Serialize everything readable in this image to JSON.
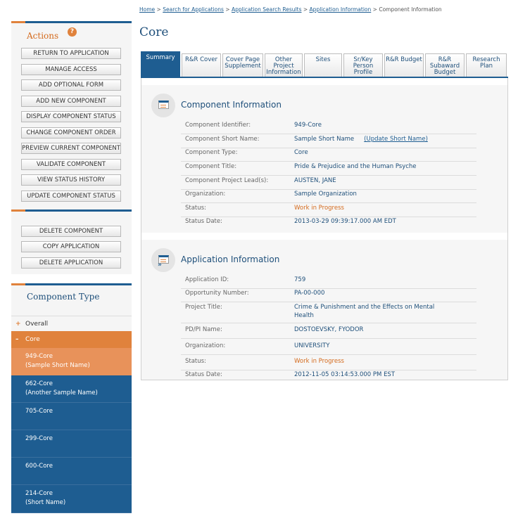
{
  "breadcrumb": [
    "Home",
    "Search for Applications",
    "Application Search Results",
    "Application Information",
    "Component Information"
  ],
  "page_title": "Core",
  "sidebar": {
    "actions_title": "Actions",
    "help_icon": "?",
    "action_buttons": [
      "RETURN TO APPLICATION",
      "MANAGE ACCESS",
      "ADD OPTIONAL FORM",
      "ADD NEW COMPONENT",
      "DISPLAY COMPONENT STATUS",
      "CHANGE COMPONENT ORDER",
      "PREVIEW CURRENT COMPONENT",
      "VALIDATE COMPONENT",
      "VIEW STATUS HISTORY",
      "UPDATE COMPONENT STATUS"
    ],
    "danger_buttons": [
      "DELETE COMPONENT",
      "COPY APPLICATION",
      "DELETE APPLICATION"
    ],
    "component_type_title": "Component Type",
    "tree": {
      "overall": {
        "toggle": "+",
        "label": "Overall"
      },
      "core": {
        "toggle": "–",
        "label": "Core"
      },
      "items": [
        {
          "line1": "949-Core",
          "line2": "(Sample Short Name)"
        },
        {
          "line1": "662-Core",
          "line2": "(Another Sample Name)"
        },
        {
          "line1": "705-Core",
          "line2": ""
        },
        {
          "line1": "299-Core",
          "line2": ""
        },
        {
          "line1": "600-Core",
          "line2": ""
        },
        {
          "line1": "214-Core",
          "line2": "(Short Name)"
        }
      ]
    }
  },
  "tabs": [
    {
      "line1": "Summary",
      "line2": "",
      "line3": ""
    },
    {
      "line1": "R&R Cover",
      "line2": "",
      "line3": ""
    },
    {
      "line1": "Cover Page",
      "line2": "Supplement",
      "line3": ""
    },
    {
      "line1": "Other",
      "line2": "Project",
      "line3": "Information"
    },
    {
      "line1": "Sites",
      "line2": "",
      "line3": ""
    },
    {
      "line1": "Sr/Key",
      "line2": "Person",
      "line3": "Profile"
    },
    {
      "line1": "R&R Budget",
      "line2": "",
      "line3": ""
    },
    {
      "line1": "R&R",
      "line2": "Subaward",
      "line3": "Budget"
    },
    {
      "line1": "Research",
      "line2": "Plan",
      "line3": ""
    }
  ],
  "component_info": {
    "title": "Component Information",
    "update_link": "(Update Short Name)",
    "rows": [
      {
        "label": "Component Identifier:",
        "value": "949-Core"
      },
      {
        "label": "Component Short Name:",
        "value": "Sample Short Name"
      },
      {
        "label": "Component Type:",
        "value": "Core"
      },
      {
        "label": "Component Title:",
        "value": "Pride & Prejudice and the Human Psyche"
      },
      {
        "label": "Component Project Lead(s):",
        "value": "AUSTEN, JANE"
      },
      {
        "label": "Organization:",
        "value": "Sample Organization"
      },
      {
        "label": "Status:",
        "value": "Work in Progress"
      },
      {
        "label": "Status Date:",
        "value": "2013-03-29 09:39:17.000 AM EDT"
      }
    ]
  },
  "application_info": {
    "title": "Application Information",
    "rows": [
      {
        "label": "Application ID:",
        "value": "759"
      },
      {
        "label": "Opportunity Number:",
        "value": "PA-00-000"
      },
      {
        "label": "Project Title:",
        "value": "Crime & Punishment and the Effects on Mental",
        "value2": "Health"
      },
      {
        "label": "PD/PI Name:",
        "value": "DOSTOEVSKY, FYODOR"
      },
      {
        "label": "Organization:",
        "value": "UNIVERSITY"
      },
      {
        "label": "Status:",
        "value": "Work in Progress"
      },
      {
        "label": "Status Date:",
        "value": "2012-11-05 03:14:53.000 PM EST"
      }
    ]
  },
  "colors": {
    "primary": "#1e5d91",
    "accent": "#e0823c",
    "status": "#d46b1e"
  }
}
